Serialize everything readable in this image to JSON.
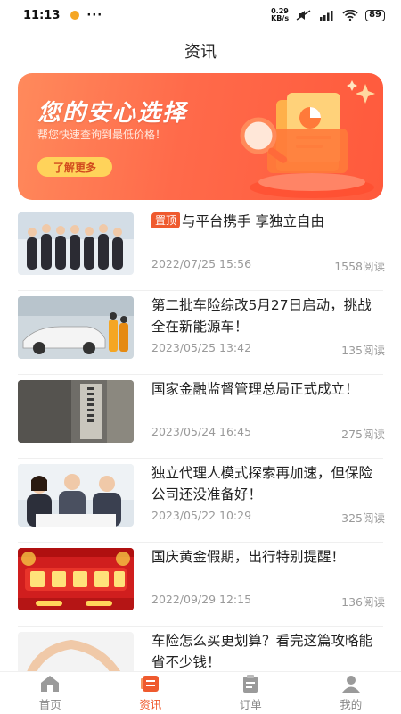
{
  "status": {
    "time": "11:13",
    "dots": "···",
    "speed_value": "0.29",
    "speed_unit": "KB/s",
    "battery": "89"
  },
  "header": {
    "title": "资讯"
  },
  "banner": {
    "title": "您的安心选择",
    "subtitle": "帮您快速查询到最低价格！",
    "button_label": "了解更多"
  },
  "news": [
    {
      "pin": "置顶",
      "title": "与平台携手 享独立自由",
      "date": "2022/07/25 15:56",
      "reads": "1558阅读"
    },
    {
      "title": "第二批车险综改5月27日启动，挑战全在新能源车！",
      "date": "2023/05/25 13:42",
      "reads": "135阅读"
    },
    {
      "title": "国家金融监督管理总局正式成立！",
      "date": "2023/05/24 16:45",
      "reads": "275阅读"
    },
    {
      "title": "独立代理人模式探索再加速，但保险公司还没准备好！",
      "date": "2023/05/22 10:29",
      "reads": "325阅读"
    },
    {
      "title": "国庆黄金假期，出行特别提醒！",
      "date": "2022/09/29 12:15",
      "reads": "136阅读"
    },
    {
      "title": "车险怎么买更划算？看完这篇攻略能省不少钱！",
      "date": "",
      "reads": ""
    }
  ],
  "tabs": [
    {
      "label": "首页",
      "icon": "home-icon"
    },
    {
      "label": "资讯",
      "icon": "news-icon"
    },
    {
      "label": "订单",
      "icon": "clipboard-icon"
    },
    {
      "label": "我的",
      "icon": "person-icon"
    }
  ],
  "colors": {
    "accent": "#ef5a2e",
    "banner": "#ff6a4a"
  }
}
